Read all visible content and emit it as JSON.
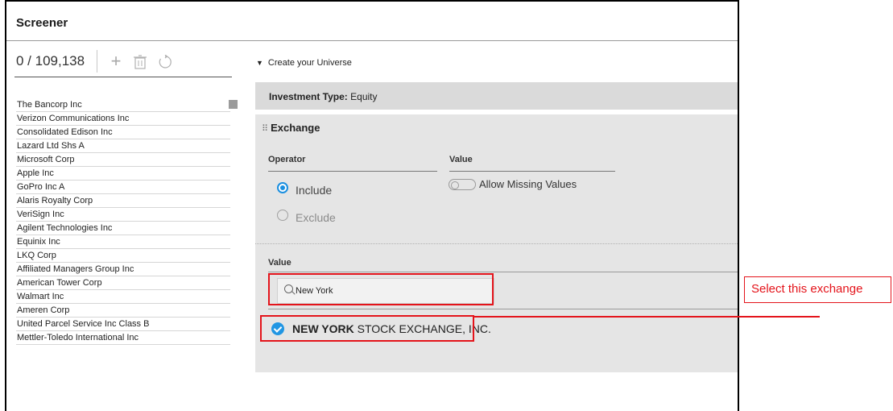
{
  "header": {
    "title": "Screener"
  },
  "toolbar": {
    "count": "0 / 109,138",
    "add_icon": "plus-icon",
    "delete_icon": "trash-icon",
    "refresh_icon": "refresh-icon"
  },
  "list": {
    "items": [
      "The Bancorp Inc",
      "Verizon Communications Inc",
      "Consolidated Edison Inc",
      "Lazard Ltd Shs A",
      "Microsoft Corp",
      "Apple Inc",
      "GoPro Inc A",
      "Alaris Royalty Corp",
      "VeriSign Inc",
      "Agilent Technologies Inc",
      "Equinix Inc",
      "LKQ Corp",
      "Affiliated Managers Group Inc",
      "American Tower Corp",
      "Walmart Inc",
      "Ameren Corp",
      "United Parcel Service Inc Class B",
      "Mettler-Toledo International Inc"
    ]
  },
  "universe": {
    "label": "Create your Universe",
    "icon": "triangle-down-icon"
  },
  "investment": {
    "label": "Investment Type:",
    "value": "Equity"
  },
  "exchange": {
    "title": "Exchange",
    "grip": "⠿",
    "operator_header": "Operator",
    "value_header": "Value",
    "include_label": "Include",
    "exclude_label": "Exclude",
    "selected_operator": "Include",
    "allow_missing_label": "Allow Missing Values",
    "value_section_label": "Value",
    "search_value": "New York",
    "result_bold": "NEW YORK",
    "result_rest": " STOCK EXCHANGE, INC."
  },
  "callout": {
    "text": "Select this exchange"
  },
  "colors": {
    "accent": "#2196e3",
    "callout": "#e4141b"
  }
}
